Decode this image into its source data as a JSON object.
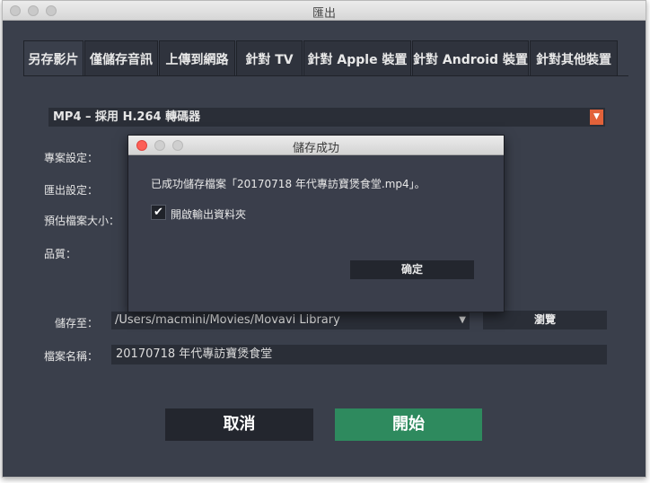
{
  "window": {
    "title": "匯出"
  },
  "tabs": [
    {
      "label": "另存影片",
      "active": true
    },
    {
      "label": "僅儲存音訊"
    },
    {
      "label": "上傳到網路"
    },
    {
      "label": "針對 TV"
    },
    {
      "label": "針對 Apple 裝置"
    },
    {
      "label": "針對 Android 裝置"
    },
    {
      "label": "針對其他裝置"
    }
  ],
  "format": {
    "value": "MP4 – 採用 H.264 轉碼器",
    "arrow": "▼"
  },
  "labels": {
    "project_settings": "專案設定：",
    "export_settings": "匯出設定：",
    "estimated_size": "預估檔案大小：",
    "quality": "品質："
  },
  "save_to": {
    "label": "儲存至：",
    "path": "/Users/macmini/Movies/Movavi Library",
    "arrow": "▼",
    "browse_label": "瀏覽"
  },
  "filename": {
    "label": "檔案名稱：",
    "value": "20170718 年代專訪寶煲食堂"
  },
  "actions": {
    "cancel_label": "取消",
    "start_label": "開始"
  },
  "dialog": {
    "title": "儲存成功",
    "message": "已成功儲存檔案「20170718 年代專訪寶煲食堂.mp4」。",
    "checkbox_checked": true,
    "checkbox_glyph": "✔",
    "checkbox_label": "開啟輸出資料夾",
    "ok_label": "确定"
  },
  "colors": {
    "panel_bg": "#3a3f4b",
    "field_bg": "#2a2e37",
    "accent_orange": "#e2623a",
    "start_green": "#2e8a5e",
    "close_red": "#fc5f57"
  }
}
